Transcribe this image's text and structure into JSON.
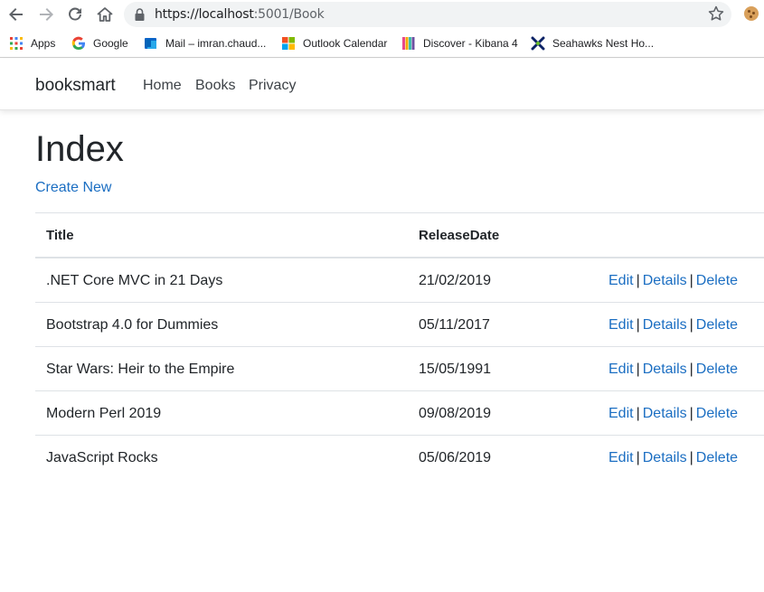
{
  "browser": {
    "url_host": "https://localhost",
    "url_path": ":5001/Book",
    "bookmarks": [
      {
        "label": "Apps",
        "icon": "apps-grid-icon"
      },
      {
        "label": "Google",
        "icon": "google-icon"
      },
      {
        "label": "Mail – imran.chaud...",
        "icon": "mail-icon"
      },
      {
        "label": "Outlook Calendar",
        "icon": "outlook-calendar-icon"
      },
      {
        "label": "Discover - Kibana 4",
        "icon": "kibana-icon"
      },
      {
        "label": "Seahawks Nest Ho...",
        "icon": "seahawks-icon"
      }
    ]
  },
  "navbar": {
    "brand": "booksmart",
    "links": [
      "Home",
      "Books",
      "Privacy"
    ]
  },
  "page": {
    "title": "Index",
    "create_link": "Create New"
  },
  "table": {
    "headers": [
      "Title",
      "ReleaseDate"
    ],
    "action_labels": [
      "Edit",
      "Details",
      "Delete"
    ],
    "separator": "|",
    "rows": [
      {
        "title": ".NET Core MVC in 21 Days",
        "release_date": "21/02/2019"
      },
      {
        "title": "Bootstrap 4.0 for Dummies",
        "release_date": "05/11/2017"
      },
      {
        "title": "Star Wars: Heir to the Empire",
        "release_date": "15/05/1991"
      },
      {
        "title": "Modern Perl 2019",
        "release_date": "09/08/2019"
      },
      {
        "title": "JavaScript Rocks",
        "release_date": "05/06/2019"
      }
    ]
  },
  "colors": {
    "link": "#1b6ec2",
    "text": "#212529",
    "border": "#dee2e6"
  }
}
